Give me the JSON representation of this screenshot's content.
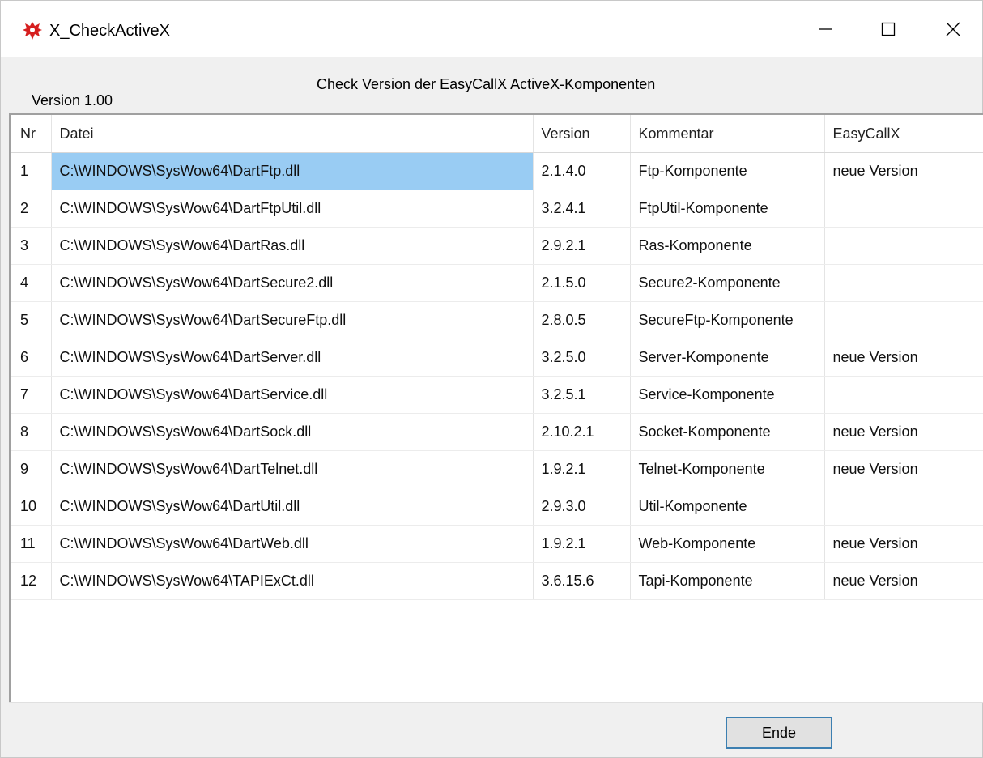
{
  "window": {
    "title": "X_CheckActiveX",
    "controls": {
      "minimize": "minimize-icon",
      "maximize": "maximize-icon",
      "close": "close-icon"
    }
  },
  "header": {
    "caption": "Check Version der EasyCallX ActiveX-Komponenten",
    "version": "Version 1.00"
  },
  "table": {
    "columns": [
      "Nr",
      "Datei",
      "Version",
      "Kommentar",
      "EasyCallX"
    ],
    "rows": [
      [
        "1",
        "C:\\WINDOWS\\SysWow64\\DartFtp.dll",
        "2.1.4.0",
        "Ftp-Komponente",
        "neue Version"
      ],
      [
        "2",
        "C:\\WINDOWS\\SysWow64\\DartFtpUtil.dll",
        "3.2.4.1",
        "FtpUtil-Komponente",
        ""
      ],
      [
        "3",
        "C:\\WINDOWS\\SysWow64\\DartRas.dll",
        "2.9.2.1",
        "Ras-Komponente",
        ""
      ],
      [
        "4",
        "C:\\WINDOWS\\SysWow64\\DartSecure2.dll",
        "2.1.5.0",
        "Secure2-Komponente",
        ""
      ],
      [
        "5",
        "C:\\WINDOWS\\SysWow64\\DartSecureFtp.dll",
        "2.8.0.5",
        "SecureFtp-Komponente",
        ""
      ],
      [
        "6",
        "C:\\WINDOWS\\SysWow64\\DartServer.dll",
        "3.2.5.0",
        "Server-Komponente",
        "neue Version"
      ],
      [
        "7",
        "C:\\WINDOWS\\SysWow64\\DartService.dll",
        "3.2.5.1",
        "Service-Komponente",
        ""
      ],
      [
        "8",
        "C:\\WINDOWS\\SysWow64\\DartSock.dll",
        "2.10.2.1",
        "Socket-Komponente",
        "neue Version"
      ],
      [
        "9",
        "C:\\WINDOWS\\SysWow64\\DartTelnet.dll",
        "1.9.2.1",
        "Telnet-Komponente",
        "neue Version"
      ],
      [
        "10",
        "C:\\WINDOWS\\SysWow64\\DartUtil.dll",
        "2.9.3.0",
        "Util-Komponente",
        ""
      ],
      [
        "11",
        "C:\\WINDOWS\\SysWow64\\DartWeb.dll",
        "1.9.2.1",
        "Web-Komponente",
        "neue Version"
      ],
      [
        "12",
        "C:\\WINDOWS\\SysWow64\\TAPIExCt.dll",
        "3.6.15.6",
        "Tapi-Komponente",
        "neue Version"
      ]
    ],
    "selected_row": 0,
    "selected_column": 1
  },
  "footer": {
    "ende_label": "Ende"
  },
  "colors": {
    "selection": "#99ccf3",
    "button_border": "#3c7fb1",
    "app_icon": "#d61f1f"
  }
}
